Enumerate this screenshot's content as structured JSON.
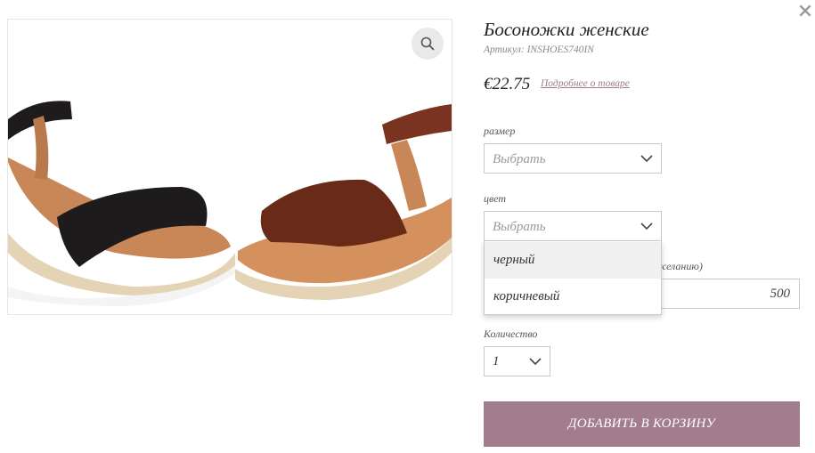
{
  "product": {
    "title": "Босоножки женские",
    "sku": "Артикул: INSHOES740IN",
    "price": "€22.75",
    "details_link": "Подробнее о товаре"
  },
  "fields": {
    "size_label": "размер",
    "size_value": "Выбрать",
    "color_label": "цвет",
    "color_value": "Выбрать",
    "color_options": [
      "черный",
      "коричневый"
    ],
    "hidden_label_fragment": "желанию)",
    "amount_value": "500",
    "quantity_label": "Количество",
    "quantity_value": "1"
  },
  "actions": {
    "add_to_cart": "ДОБАВИТЬ В КОРЗИНУ"
  },
  "icons": {
    "close": "close-icon",
    "zoom": "magnifier-icon",
    "chevron": "chevron-down-icon"
  },
  "colors": {
    "accent": "#a27d8e",
    "link": "#a27b8f",
    "border": "#c9c9c9"
  }
}
